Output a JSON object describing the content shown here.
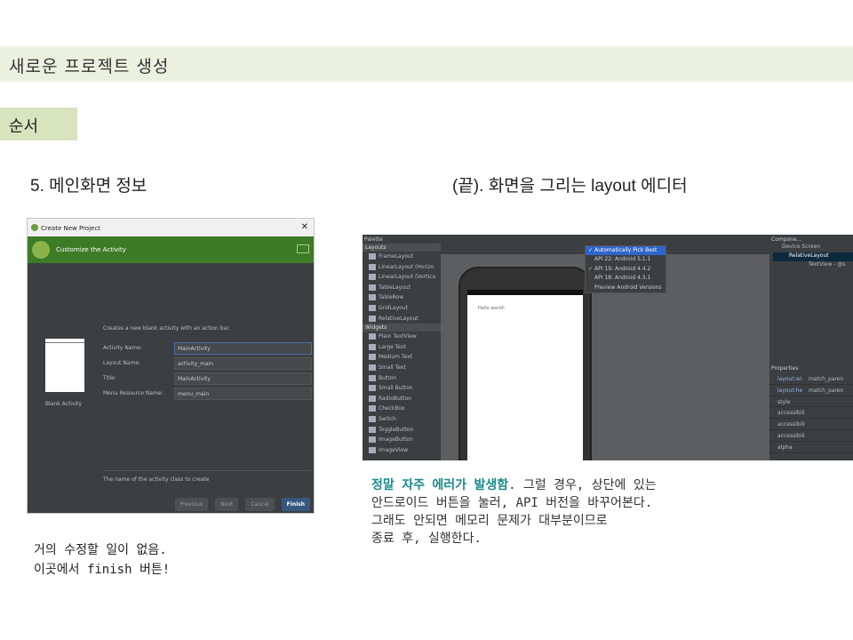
{
  "title": "새로운 프로젝트 생성",
  "section": "순서",
  "left_heading": "5. 메인화면 정보",
  "right_heading": "(끝). 화면을 그리는 layout 에디터",
  "wizard": {
    "window_title": "Create New Project",
    "header": "Customize the Activity",
    "description": "Creates a new blank activity with an action bar.",
    "thumbnail_label": "Blank Activity",
    "fields": [
      {
        "label": "Activity Name:",
        "value": "MainActivity"
      },
      {
        "label": "Layout Name:",
        "value": "activity_main"
      },
      {
        "label": "Title:",
        "value": "MainActivity"
      },
      {
        "label": "Menu Resource Name:",
        "value": "menu_main"
      }
    ],
    "hint": "The name of the activity class to create",
    "buttons": {
      "previous": "Previous",
      "next": "Next",
      "cancel": "Cancel",
      "finish": "Finish"
    }
  },
  "left_note": [
    "거의 수정할 일이 없음.",
    "이곳에서 finish 버튼!"
  ],
  "ide": {
    "palette_title": "Palette",
    "palette_groups": [
      {
        "name": "Layouts",
        "items": [
          "FrameLayout",
          "LinearLayout (Horizo",
          "LinearLayout (Vertica",
          "TableLayout",
          "TableRow",
          "GridLayout",
          "RelativeLayout"
        ]
      },
      {
        "name": "Widgets",
        "items": [
          "Plain TextView",
          "Large Text",
          "Medium Text",
          "Small Text",
          "Button",
          "Small Button",
          "RadioButton",
          "CheckBox",
          "Switch",
          "ToggleButton",
          "ImageButton",
          "ImageView"
        ]
      }
    ],
    "api_menu": [
      {
        "label": "Automatically Pick Best",
        "checked": true,
        "selected": true
      },
      {
        "label": "API 22: Android 5.1.1",
        "checked": false,
        "selected": false
      },
      {
        "label": "API 19: Android 4.4.2",
        "checked": true,
        "selected": false
      },
      {
        "label": "API 18: Android 4.3.1",
        "checked": false,
        "selected": false
      },
      {
        "label": "Preview Android Versions",
        "checked": false,
        "selected": false
      }
    ],
    "hello_text": "Hello world!",
    "component_title": "Compone...",
    "tree": [
      "Device Screen",
      "RelativeLayout",
      "TextView - @s"
    ],
    "properties_title": "Properties",
    "properties": [
      {
        "key": "layout:wi",
        "value": "match_paren"
      },
      {
        "key": "layout:he",
        "value": "match_paren"
      },
      {
        "key": "style",
        "value": ""
      },
      {
        "key": "accessibili",
        "value": ""
      },
      {
        "key": "accessibili",
        "value": ""
      },
      {
        "key": "accessibili",
        "value": ""
      },
      {
        "key": "alpha",
        "value": ""
      }
    ]
  },
  "right_note": {
    "emphasis": "정말 자주 에러가 발생함",
    "line1_rest": ". 그럴 경우, 상단에 있는",
    "line2": "안드로이드 버튼을 눌러, API 버전을 바꾸어본다.",
    "line3": "그래도 안되면 메모리 문제가 대부분이므로",
    "line4": "종료 후, 실행한다."
  },
  "colors": {
    "title_band": "#ebf1de",
    "section_band": "#d7e4bd",
    "emphasis": "#1b8a8c",
    "wizard_header": "#3e7b27"
  }
}
